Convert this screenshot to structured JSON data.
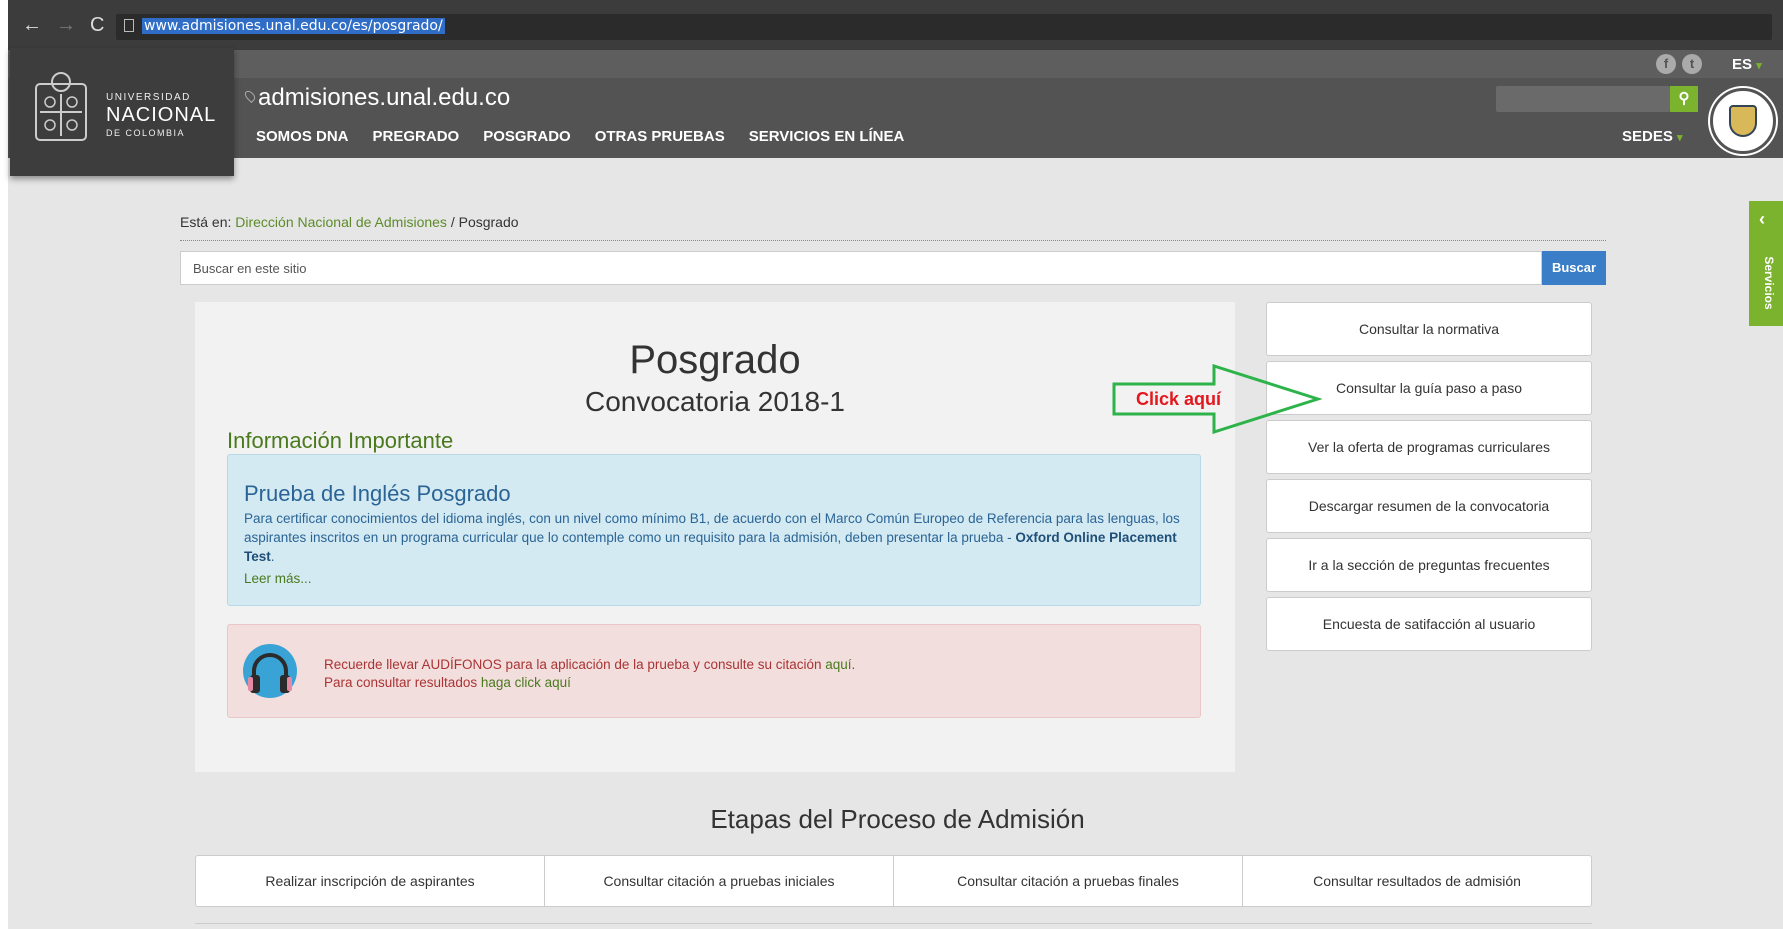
{
  "browser": {
    "url": "www.admisiones.unal.edu.co/es/posgrado/"
  },
  "header": {
    "logo": {
      "line1": "UNIVERSIDAD",
      "line2": "NACIONAL",
      "line3": "DE COLOMBIA"
    },
    "site_title": "admisiones.unal.edu.co",
    "menu": [
      "SOMOS DNA",
      "PREGRADO",
      "POSGRADO",
      "OTRAS PRUEBAS",
      "SERVICIOS EN LÍNEA"
    ],
    "lang": "ES",
    "sedes": "SEDES",
    "social_icons": [
      "facebook-icon",
      "twitter-icon"
    ]
  },
  "side_tab": {
    "label": "Servicios"
  },
  "breadcrumb": {
    "prefix": "Está en:",
    "link": "Dirección Nacional de Admisiones",
    "separator": "/",
    "current": "Posgrado"
  },
  "site_search": {
    "placeholder": "Buscar en este sitio",
    "button": "Buscar"
  },
  "main": {
    "title": "Posgrado",
    "subtitle": "Convocatoria 2018-1",
    "section_head": "Información Importante",
    "info": {
      "title": "Prueba de Inglés Posgrado",
      "body": "Para certificar conocimientos del idioma inglés, con un nivel como mínimo B1, de acuerdo con el Marco Común Europeo de Referencia para las lenguas, los aspirantes inscritos en un programa curricular que lo contemple como un requisito para la admisión, deben presentar la prueba - ",
      "body_bold": "Oxford Online Placement Test",
      "body_end": ".",
      "more": "Leer más..."
    },
    "alert": {
      "line1_pre": "Recuerde llevar AUDÍFONOS para la aplicación de la prueba y consulte su citación ",
      "line1_link": "aquí",
      "line1_end": ".",
      "line2_pre": "Para consultar resultados ",
      "line2_link": "haga click aquí"
    }
  },
  "actions": [
    "Consultar la normativa",
    "Consultar la guía paso a paso",
    "Ver la oferta de programas curriculares",
    "Descargar resumen de la convocatoria",
    "Ir a la sección de preguntas frecuentes",
    "Encuesta de satifacción al usuario"
  ],
  "annotation": {
    "label": "Click aquí",
    "color": "#e3171d",
    "arrow_color": "#2db34a"
  },
  "stages": {
    "title": "Etapas del Proceso de Admisión",
    "items": [
      "Realizar inscripción de aspirantes",
      "Consultar citación a pruebas iniciales",
      "Consultar citación a pruebas finales",
      "Consultar resultados de admisión"
    ]
  },
  "colors": {
    "accent_green": "#7bb32e",
    "header_gray": "#535353",
    "button_blue": "#3a7ec7"
  }
}
